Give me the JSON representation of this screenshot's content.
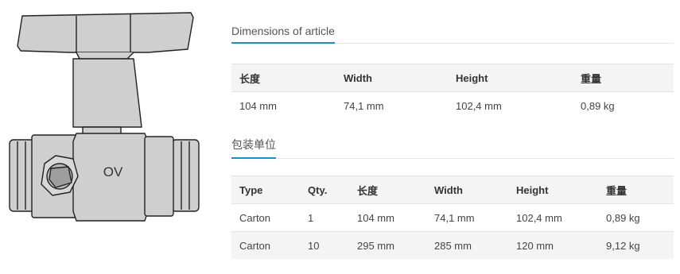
{
  "dimensions": {
    "title": "Dimensions of article",
    "headers": [
      "长度",
      "Width",
      "Height",
      "重量"
    ],
    "rows": [
      [
        "104 mm",
        "74,1 mm",
        "102,4 mm",
        "0,89 kg"
      ]
    ]
  },
  "packaging": {
    "title": "包装单位",
    "headers": [
      "Type",
      "Qty.",
      "长度",
      "Width",
      "Height",
      "重量"
    ],
    "rows": [
      [
        "Carton",
        "1",
        "104 mm",
        "74,1 mm",
        "102,4 mm",
        "0,89 kg"
      ],
      [
        "Carton",
        "10",
        "295 mm",
        "285 mm",
        "120 mm",
        "9,12 kg"
      ]
    ]
  },
  "product": {
    "marking": "OV"
  },
  "colors": {
    "accent": "#1a8fc9",
    "header_bg": "#f4f4f4"
  }
}
